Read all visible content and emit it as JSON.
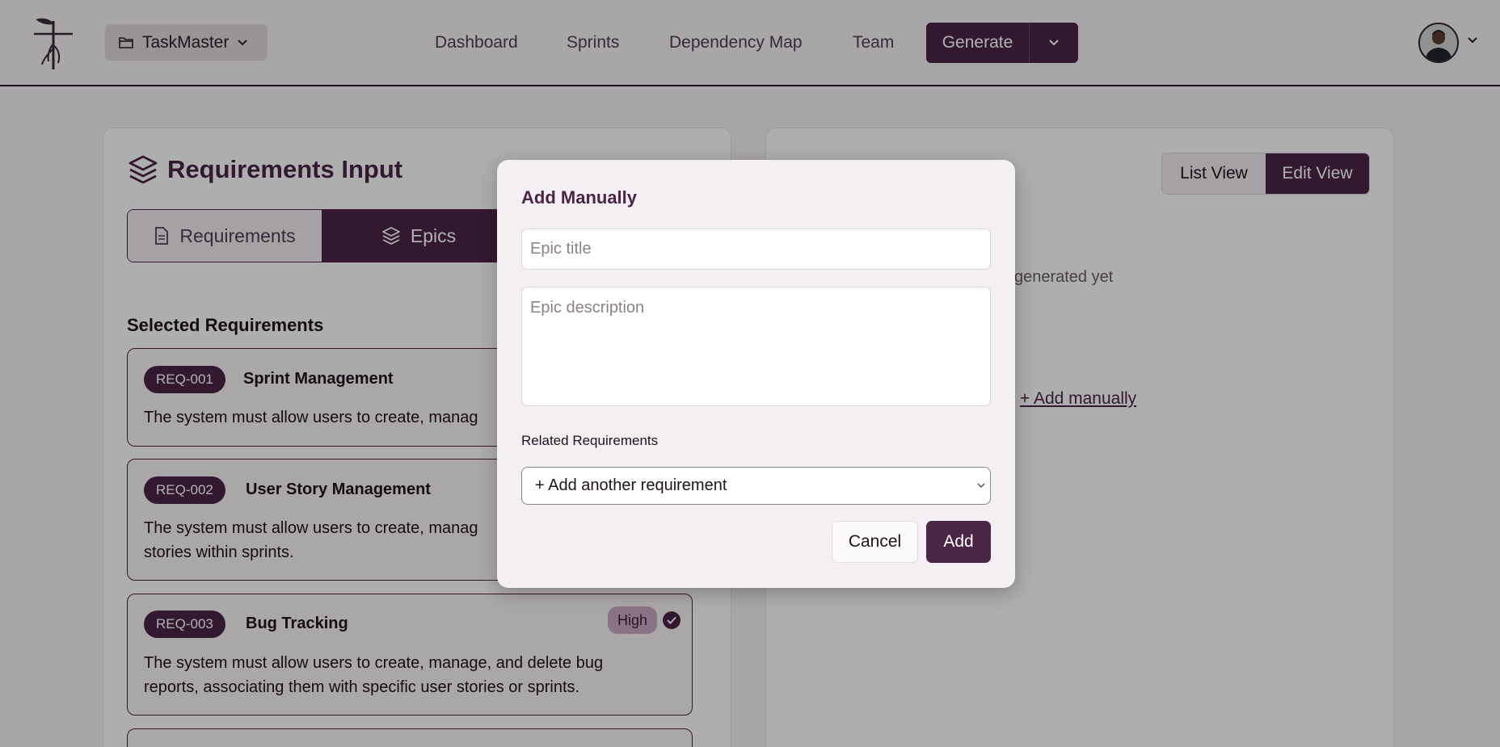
{
  "header": {
    "project_name": "TaskMaster",
    "nav": [
      "Dashboard",
      "Sprints",
      "Dependency Map",
      "Team"
    ],
    "generate_label": "Generate"
  },
  "left_panel": {
    "title": "Requirements Input",
    "tabs": [
      "Requirements",
      "Epics"
    ],
    "selected_heading": "Selected Requirements",
    "requirements": [
      {
        "id": "REQ-001",
        "name": "Sprint Management",
        "desc_line1": "The system must allow users to create, manag",
        "desc_line2": ""
      },
      {
        "id": "REQ-002",
        "name": "User Story Management",
        "desc_line1": "The system must allow users to create, manag",
        "desc_line2": "stories within sprints."
      },
      {
        "id": "REQ-003",
        "name": "Bug Tracking",
        "priority": "High",
        "desc_line1": "The system must allow users to create, manage, and delete bug",
        "desc_line2": "reports, associating them with specific user stories or sprints."
      }
    ]
  },
  "right_panel": {
    "view_toggle": [
      "List View",
      "Edit View"
    ],
    "empty_text": "epics generated yet",
    "add_link": "+ Add manually"
  },
  "modal": {
    "title": "Add Manually",
    "title_placeholder": "Epic title",
    "description_placeholder": "Epic description",
    "related_label": "Related Requirements",
    "select_value": "+ Add another requirement",
    "cancel_label": "Cancel",
    "add_label": "Add"
  }
}
